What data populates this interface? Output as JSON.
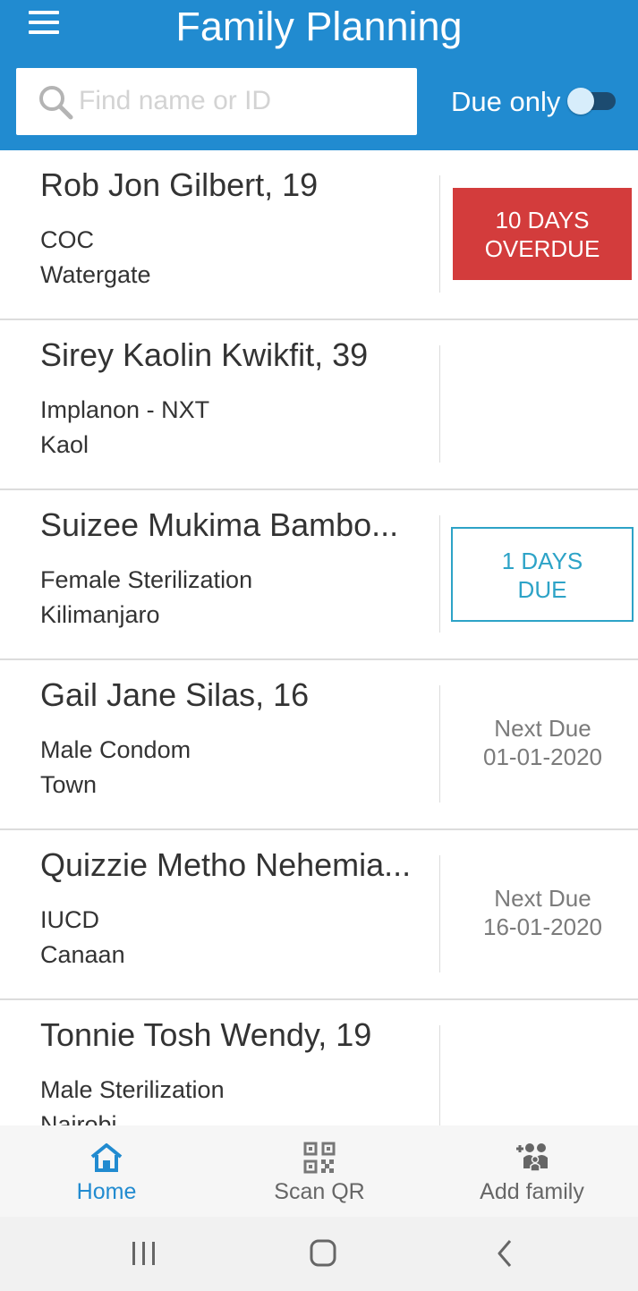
{
  "header": {
    "title": "Family Planning",
    "search_placeholder": "Find name or ID",
    "due_only_label": "Due only",
    "due_only_enabled": false,
    "accent_color": "#218bd0"
  },
  "clients": [
    {
      "name": "Rob Jon Gilbert, 19",
      "method": "COC",
      "location": "Watergate",
      "status_type": "overdue",
      "status_text": "10 DAYS\nOVERDUE"
    },
    {
      "name": "Sirey Kaolin Kwikfit, 39",
      "method": "Implanon - NXT",
      "location": "Kaol",
      "status_type": "none",
      "status_text": ""
    },
    {
      "name": "Suizee Mukima Bambo...",
      "method": "Female Sterilization",
      "location": "Kilimanjaro",
      "status_type": "due",
      "status_text": "1 DAYS\nDUE"
    },
    {
      "name": "Gail Jane Silas, 16",
      "method": "Male Condom",
      "location": "Town",
      "status_type": "next",
      "status_text": "Next Due\n01-01-2020"
    },
    {
      "name": "Quizzie Metho Nehemia...",
      "method": "IUCD",
      "location": "Canaan",
      "status_type": "next",
      "status_text": "Next Due\n16-01-2020"
    },
    {
      "name": "Tonnie Tosh Wendy, 19",
      "method": "Male Sterilization",
      "location": "Nairobi",
      "status_type": "none",
      "status_text": ""
    }
  ],
  "bottom_nav": {
    "home": {
      "label": "Home",
      "icon": "home-icon",
      "active": true
    },
    "scan": {
      "label": "Scan QR",
      "icon": "qr-code-icon",
      "active": false
    },
    "add_family": {
      "label": "Add family",
      "icon": "add-family-icon",
      "active": false
    }
  },
  "colors": {
    "overdue": "#d33c3c",
    "due": "#2da3c7",
    "next_due_text": "#7b7b7b"
  }
}
